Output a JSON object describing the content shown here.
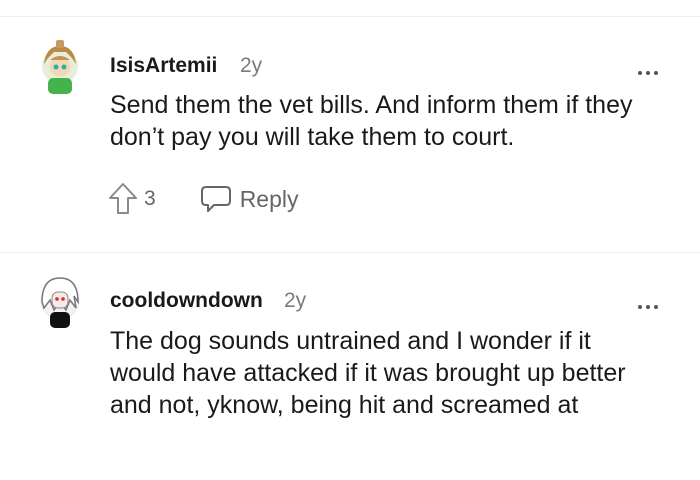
{
  "comments": [
    {
      "username": "IsisArtemii",
      "age": "2y",
      "body": "Send them the vet bills. And inform them if they don’t pay you will take them to court.",
      "votes": "3",
      "reply_label": "Reply",
      "icons": {
        "avatar": "avatar-green-hair-icon",
        "more": "more-options-icon",
        "upvote": "upvote-arrow-icon",
        "reply": "speech-bubble-icon"
      }
    },
    {
      "username": "cooldowndown",
      "age": "2y",
      "body": "The dog sounds untrained and I wonder if it would have attacked if it was brought up better and not, yknow, being hit and screamed at",
      "icons": {
        "avatar": "avatar-white-hair-icon",
        "more": "more-options-icon"
      }
    }
  ],
  "colors": {
    "divider": "#edeff1",
    "muted": "#7c7c7c",
    "text": "#1a1a1b"
  }
}
